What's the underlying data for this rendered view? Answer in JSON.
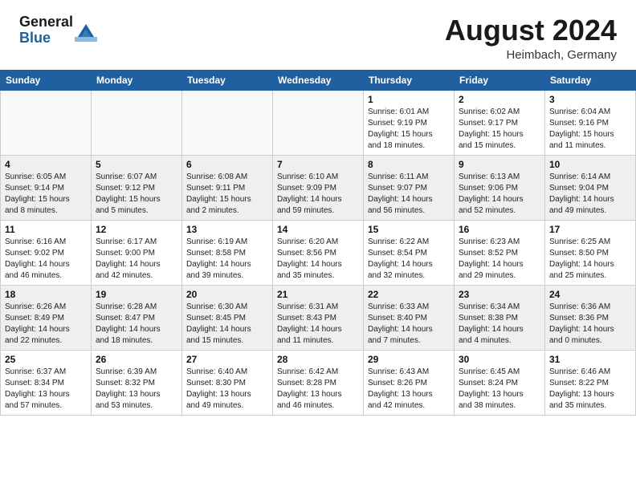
{
  "header": {
    "logo_general": "General",
    "logo_blue": "Blue",
    "month_year": "August 2024",
    "location": "Heimbach, Germany"
  },
  "calendar": {
    "days_of_week": [
      "Sunday",
      "Monday",
      "Tuesday",
      "Wednesday",
      "Thursday",
      "Friday",
      "Saturday"
    ],
    "weeks": [
      [
        {
          "day": "",
          "info": ""
        },
        {
          "day": "",
          "info": ""
        },
        {
          "day": "",
          "info": ""
        },
        {
          "day": "",
          "info": ""
        },
        {
          "day": "1",
          "info": "Sunrise: 6:01 AM\nSunset: 9:19 PM\nDaylight: 15 hours\nand 18 minutes."
        },
        {
          "day": "2",
          "info": "Sunrise: 6:02 AM\nSunset: 9:17 PM\nDaylight: 15 hours\nand 15 minutes."
        },
        {
          "day": "3",
          "info": "Sunrise: 6:04 AM\nSunset: 9:16 PM\nDaylight: 15 hours\nand 11 minutes."
        }
      ],
      [
        {
          "day": "4",
          "info": "Sunrise: 6:05 AM\nSunset: 9:14 PM\nDaylight: 15 hours\nand 8 minutes."
        },
        {
          "day": "5",
          "info": "Sunrise: 6:07 AM\nSunset: 9:12 PM\nDaylight: 15 hours\nand 5 minutes."
        },
        {
          "day": "6",
          "info": "Sunrise: 6:08 AM\nSunset: 9:11 PM\nDaylight: 15 hours\nand 2 minutes."
        },
        {
          "day": "7",
          "info": "Sunrise: 6:10 AM\nSunset: 9:09 PM\nDaylight: 14 hours\nand 59 minutes."
        },
        {
          "day": "8",
          "info": "Sunrise: 6:11 AM\nSunset: 9:07 PM\nDaylight: 14 hours\nand 56 minutes."
        },
        {
          "day": "9",
          "info": "Sunrise: 6:13 AM\nSunset: 9:06 PM\nDaylight: 14 hours\nand 52 minutes."
        },
        {
          "day": "10",
          "info": "Sunrise: 6:14 AM\nSunset: 9:04 PM\nDaylight: 14 hours\nand 49 minutes."
        }
      ],
      [
        {
          "day": "11",
          "info": "Sunrise: 6:16 AM\nSunset: 9:02 PM\nDaylight: 14 hours\nand 46 minutes."
        },
        {
          "day": "12",
          "info": "Sunrise: 6:17 AM\nSunset: 9:00 PM\nDaylight: 14 hours\nand 42 minutes."
        },
        {
          "day": "13",
          "info": "Sunrise: 6:19 AM\nSunset: 8:58 PM\nDaylight: 14 hours\nand 39 minutes."
        },
        {
          "day": "14",
          "info": "Sunrise: 6:20 AM\nSunset: 8:56 PM\nDaylight: 14 hours\nand 35 minutes."
        },
        {
          "day": "15",
          "info": "Sunrise: 6:22 AM\nSunset: 8:54 PM\nDaylight: 14 hours\nand 32 minutes."
        },
        {
          "day": "16",
          "info": "Sunrise: 6:23 AM\nSunset: 8:52 PM\nDaylight: 14 hours\nand 29 minutes."
        },
        {
          "day": "17",
          "info": "Sunrise: 6:25 AM\nSunset: 8:50 PM\nDaylight: 14 hours\nand 25 minutes."
        }
      ],
      [
        {
          "day": "18",
          "info": "Sunrise: 6:26 AM\nSunset: 8:49 PM\nDaylight: 14 hours\nand 22 minutes."
        },
        {
          "day": "19",
          "info": "Sunrise: 6:28 AM\nSunset: 8:47 PM\nDaylight: 14 hours\nand 18 minutes."
        },
        {
          "day": "20",
          "info": "Sunrise: 6:30 AM\nSunset: 8:45 PM\nDaylight: 14 hours\nand 15 minutes."
        },
        {
          "day": "21",
          "info": "Sunrise: 6:31 AM\nSunset: 8:43 PM\nDaylight: 14 hours\nand 11 minutes."
        },
        {
          "day": "22",
          "info": "Sunrise: 6:33 AM\nSunset: 8:40 PM\nDaylight: 14 hours\nand 7 minutes."
        },
        {
          "day": "23",
          "info": "Sunrise: 6:34 AM\nSunset: 8:38 PM\nDaylight: 14 hours\nand 4 minutes."
        },
        {
          "day": "24",
          "info": "Sunrise: 6:36 AM\nSunset: 8:36 PM\nDaylight: 14 hours\nand 0 minutes."
        }
      ],
      [
        {
          "day": "25",
          "info": "Sunrise: 6:37 AM\nSunset: 8:34 PM\nDaylight: 13 hours\nand 57 minutes."
        },
        {
          "day": "26",
          "info": "Sunrise: 6:39 AM\nSunset: 8:32 PM\nDaylight: 13 hours\nand 53 minutes."
        },
        {
          "day": "27",
          "info": "Sunrise: 6:40 AM\nSunset: 8:30 PM\nDaylight: 13 hours\nand 49 minutes."
        },
        {
          "day": "28",
          "info": "Sunrise: 6:42 AM\nSunset: 8:28 PM\nDaylight: 13 hours\nand 46 minutes."
        },
        {
          "day": "29",
          "info": "Sunrise: 6:43 AM\nSunset: 8:26 PM\nDaylight: 13 hours\nand 42 minutes."
        },
        {
          "day": "30",
          "info": "Sunrise: 6:45 AM\nSunset: 8:24 PM\nDaylight: 13 hours\nand 38 minutes."
        },
        {
          "day": "31",
          "info": "Sunrise: 6:46 AM\nSunset: 8:22 PM\nDaylight: 13 hours\nand 35 minutes."
        }
      ]
    ]
  }
}
